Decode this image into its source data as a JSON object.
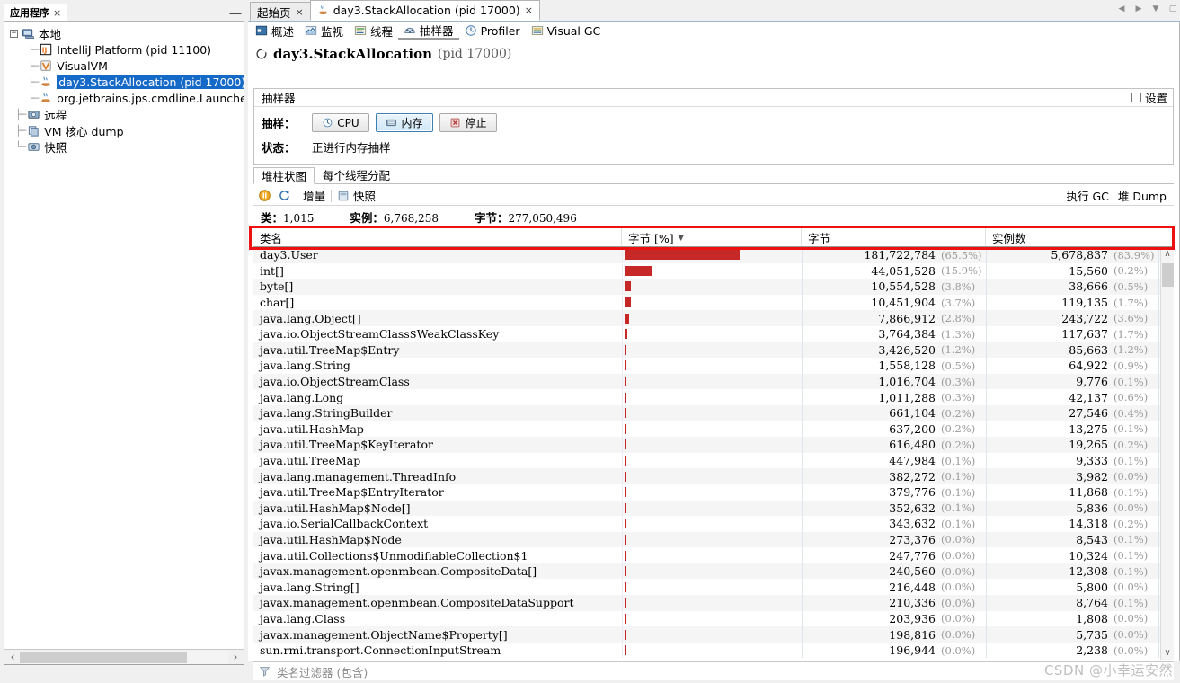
{
  "left_panel": {
    "tab_label": "应用程序",
    "tab_close": "×",
    "minimize": "—",
    "tree": [
      {
        "label": "本地",
        "icon": "computer-icon",
        "depth": 0,
        "expander": "-",
        "selected": false
      },
      {
        "label": "IntelliJ Platform (pid 11100)",
        "icon": "intellij-icon",
        "depth": 1,
        "expander": "",
        "selected": false
      },
      {
        "label": "VisualVM",
        "icon": "visualvm-icon",
        "depth": 1,
        "expander": "",
        "selected": false
      },
      {
        "label": "day3.StackAllocation (pid 17000)",
        "icon": "java-icon",
        "depth": 1,
        "expander": "",
        "selected": true
      },
      {
        "label": "org.jetbrains.jps.cmdline.Launcher",
        "icon": "java-icon",
        "depth": 1,
        "expander": "",
        "selected": false
      },
      {
        "label": "远程",
        "icon": "remote-icon",
        "depth": 0,
        "expander": "",
        "selected": false
      },
      {
        "label": "VM 核心 dump",
        "icon": "coredump-icon",
        "depth": 0,
        "expander": "",
        "selected": false
      },
      {
        "label": "快照",
        "icon": "snapshot-icon",
        "depth": 0,
        "expander": "",
        "selected": false
      }
    ]
  },
  "window_controls": {
    "prev": "◀",
    "next": "▶",
    "dropdown": "▼",
    "maximize": "▢"
  },
  "doc_tabs": [
    {
      "label": "起始页",
      "close": "×",
      "active": false,
      "icon": ""
    },
    {
      "label": "day3.StackAllocation (pid 17000)",
      "close": "×",
      "active": true,
      "icon": "java-icon"
    }
  ],
  "sub_tabs": [
    {
      "label": "概述",
      "icon": "overview-icon",
      "active": false
    },
    {
      "label": "监视",
      "icon": "monitor-icon",
      "active": false
    },
    {
      "label": "线程",
      "icon": "threads-icon",
      "active": false
    },
    {
      "label": "抽样器",
      "icon": "sampler-icon",
      "active": true
    },
    {
      "label": "Profiler",
      "icon": "profiler-icon",
      "active": false
    },
    {
      "label": "Visual GC",
      "icon": "visualgc-icon",
      "active": false
    }
  ],
  "app_title": {
    "name": "day3.StackAllocation",
    "pid": "(pid 17000)",
    "status_icon": "running-icon"
  },
  "sampler": {
    "panel_title": "抽样器",
    "settings_label": "设置",
    "sampling_label": "抽样：",
    "status_label": "状态：",
    "status_value": "正进行内存抽样",
    "buttons": [
      {
        "label": "CPU",
        "icon": "cpu-icon",
        "selected": false
      },
      {
        "label": "内存",
        "icon": "memory-icon",
        "selected": true
      },
      {
        "label": "停止",
        "icon": "stop-icon",
        "selected": false
      }
    ]
  },
  "inner_tabs": [
    {
      "label": "堆柱状图",
      "active": true
    },
    {
      "label": "每个线程分配",
      "active": false
    }
  ],
  "toolbar": {
    "pause_icon": "pause-icon",
    "refresh_icon": "refresh-icon",
    "delta_label": "增量",
    "snapshot_label": "快照",
    "snapshot_icon": "snapshot-icon",
    "gc_label": "执行 GC",
    "heapdump_label": "堆 Dump"
  },
  "stats": {
    "classes_label": "类：",
    "classes_value": "1,015",
    "instances_label": "实例：",
    "instances_value": "6,768,258",
    "bytes_label": "字节：",
    "bytes_value": "277,050,496"
  },
  "filter": {
    "icon": "filter-icon",
    "placeholder": "类名过滤器 (包含)"
  },
  "watermark": "CSDN @小幸运安然",
  "colors": {
    "bar": "#c62828",
    "selection": "#1569c7",
    "annotation": "#ee1111"
  },
  "chart_data": {
    "type": "table",
    "title": "堆柱状图",
    "columns": [
      "类名",
      "字节 [%]",
      "字节",
      "实例数"
    ],
    "sort_column": "字节 [%]",
    "sort_dir": "desc",
    "total_bytes": 277050496,
    "rows": [
      {
        "name": "day3.User",
        "bar_pct": 65.5,
        "bytes": "181,722,784",
        "bytes_pct": "(65.5%)",
        "count": "5,678,837",
        "count_pct": "(83.9%)"
      },
      {
        "name": "int[]",
        "bar_pct": 15.9,
        "bytes": "44,051,528",
        "bytes_pct": "(15.9%)",
        "count": "15,560",
        "count_pct": "(0.2%)"
      },
      {
        "name": "byte[]",
        "bar_pct": 3.8,
        "bytes": "10,554,528",
        "bytes_pct": "(3.8%)",
        "count": "38,666",
        "count_pct": "(0.5%)"
      },
      {
        "name": "char[]",
        "bar_pct": 3.7,
        "bytes": "10,451,904",
        "bytes_pct": "(3.7%)",
        "count": "119,135",
        "count_pct": "(1.7%)"
      },
      {
        "name": "java.lang.Object[]",
        "bar_pct": 2.8,
        "bytes": "7,866,912",
        "bytes_pct": "(2.8%)",
        "count": "243,722",
        "count_pct": "(3.6%)"
      },
      {
        "name": "java.io.ObjectStreamClass$WeakClassKey",
        "bar_pct": 1.3,
        "bytes": "3,764,384",
        "bytes_pct": "(1.3%)",
        "count": "117,637",
        "count_pct": "(1.7%)"
      },
      {
        "name": "java.util.TreeMap$Entry",
        "bar_pct": 1.2,
        "bytes": "3,426,520",
        "bytes_pct": "(1.2%)",
        "count": "85,663",
        "count_pct": "(1.2%)"
      },
      {
        "name": "java.lang.String",
        "bar_pct": 0.5,
        "bytes": "1,558,128",
        "bytes_pct": "(0.5%)",
        "count": "64,922",
        "count_pct": "(0.9%)"
      },
      {
        "name": "java.io.ObjectStreamClass",
        "bar_pct": 0.3,
        "bytes": "1,016,704",
        "bytes_pct": "(0.3%)",
        "count": "9,776",
        "count_pct": "(0.1%)"
      },
      {
        "name": "java.lang.Long",
        "bar_pct": 0.3,
        "bytes": "1,011,288",
        "bytes_pct": "(0.3%)",
        "count": "42,137",
        "count_pct": "(0.6%)"
      },
      {
        "name": "java.lang.StringBuilder",
        "bar_pct": 0.2,
        "bytes": "661,104",
        "bytes_pct": "(0.2%)",
        "count": "27,546",
        "count_pct": "(0.4%)"
      },
      {
        "name": "java.util.HashMap",
        "bar_pct": 0.2,
        "bytes": "637,200",
        "bytes_pct": "(0.2%)",
        "count": "13,275",
        "count_pct": "(0.1%)"
      },
      {
        "name": "java.util.TreeMap$KeyIterator",
        "bar_pct": 0.2,
        "bytes": "616,480",
        "bytes_pct": "(0.2%)",
        "count": "19,265",
        "count_pct": "(0.2%)"
      },
      {
        "name": "java.util.TreeMap",
        "bar_pct": 0.1,
        "bytes": "447,984",
        "bytes_pct": "(0.1%)",
        "count": "9,333",
        "count_pct": "(0.1%)"
      },
      {
        "name": "java.lang.management.ThreadInfo",
        "bar_pct": 0.1,
        "bytes": "382,272",
        "bytes_pct": "(0.1%)",
        "count": "3,982",
        "count_pct": "(0.0%)"
      },
      {
        "name": "java.util.TreeMap$EntryIterator",
        "bar_pct": 0.1,
        "bytes": "379,776",
        "bytes_pct": "(0.1%)",
        "count": "11,868",
        "count_pct": "(0.1%)"
      },
      {
        "name": "java.util.HashMap$Node[]",
        "bar_pct": 0.1,
        "bytes": "352,632",
        "bytes_pct": "(0.1%)",
        "count": "5,836",
        "count_pct": "(0.0%)"
      },
      {
        "name": "java.io.SerialCallbackContext",
        "bar_pct": 0.1,
        "bytes": "343,632",
        "bytes_pct": "(0.1%)",
        "count": "14,318",
        "count_pct": "(0.2%)"
      },
      {
        "name": "java.util.HashMap$Node",
        "bar_pct": 0.0,
        "bytes": "273,376",
        "bytes_pct": "(0.0%)",
        "count": "8,543",
        "count_pct": "(0.1%)"
      },
      {
        "name": "java.util.Collections$UnmodifiableCollection$1",
        "bar_pct": 0.0,
        "bytes": "247,776",
        "bytes_pct": "(0.0%)",
        "count": "10,324",
        "count_pct": "(0.1%)"
      },
      {
        "name": "javax.management.openmbean.CompositeData[]",
        "bar_pct": 0.0,
        "bytes": "240,560",
        "bytes_pct": "(0.0%)",
        "count": "12,308",
        "count_pct": "(0.1%)"
      },
      {
        "name": "java.lang.String[]",
        "bar_pct": 0.0,
        "bytes": "216,448",
        "bytes_pct": "(0.0%)",
        "count": "5,800",
        "count_pct": "(0.0%)"
      },
      {
        "name": "javax.management.openmbean.CompositeDataSupport",
        "bar_pct": 0.0,
        "bytes": "210,336",
        "bytes_pct": "(0.0%)",
        "count": "8,764",
        "count_pct": "(0.1%)"
      },
      {
        "name": "java.lang.Class",
        "bar_pct": 0.0,
        "bytes": "203,936",
        "bytes_pct": "(0.0%)",
        "count": "1,808",
        "count_pct": "(0.0%)"
      },
      {
        "name": "javax.management.ObjectName$Property[]",
        "bar_pct": 0.0,
        "bytes": "198,816",
        "bytes_pct": "(0.0%)",
        "count": "5,735",
        "count_pct": "(0.0%)"
      },
      {
        "name": "sun.rmi.transport.ConnectionInputStream",
        "bar_pct": 0.0,
        "bytes": "196,944",
        "bytes_pct": "(0.0%)",
        "count": "2,238",
        "count_pct": "(0.0%)"
      }
    ]
  }
}
